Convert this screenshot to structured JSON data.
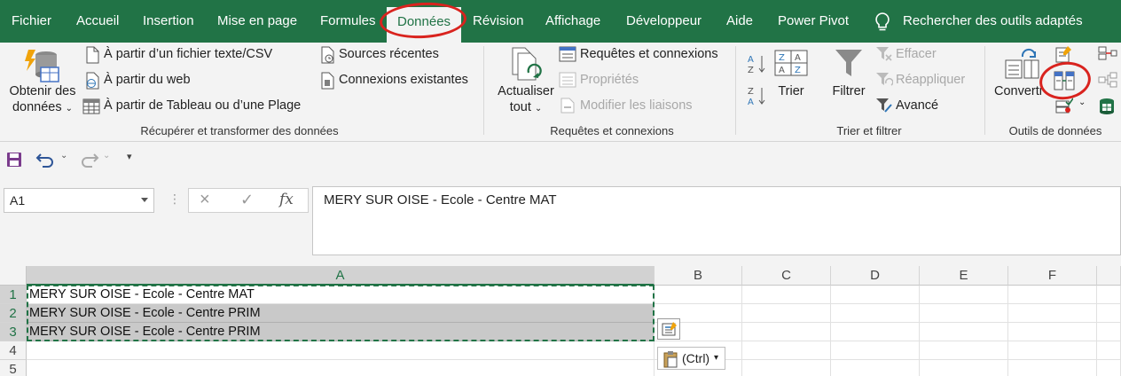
{
  "tabs": [
    {
      "label": "Fichier",
      "active": false
    },
    {
      "label": "Accueil",
      "active": false
    },
    {
      "label": "Insertion",
      "active": false
    },
    {
      "label": "Mise en page",
      "active": false
    },
    {
      "label": "Formules",
      "active": false
    },
    {
      "label": "Données",
      "active": true
    },
    {
      "label": "Révision",
      "active": false
    },
    {
      "label": "Affichage",
      "active": false
    },
    {
      "label": "Développeur",
      "active": false
    },
    {
      "label": "Aide",
      "active": false
    },
    {
      "label": "Power Pivot",
      "active": false
    }
  ],
  "search": {
    "label": "Rechercher des outils adaptés",
    "icon": "lightbulb-icon"
  },
  "ribbon": {
    "get_transform": {
      "get_data": {
        "line1": "Obtenir des",
        "line2": "données"
      },
      "from_text_csv": "À partir d’un fichier texte/CSV",
      "from_web": "À partir du web",
      "from_table": "À partir de Tableau ou d’une Plage",
      "recent_sources": "Sources récentes",
      "existing_connections": "Connexions existantes",
      "group_label": "Récupérer et transformer des données"
    },
    "queries": {
      "refresh": {
        "line1": "Actualiser",
        "line2": "tout"
      },
      "queries_connections": "Requêtes et connexions",
      "properties": "Propriétés",
      "edit_links": "Modifier les liaisons",
      "group_label": "Requêtes et connexions"
    },
    "sort_filter": {
      "sort": "Trier",
      "filter": "Filtrer",
      "clear": "Effacer",
      "reapply": "Réappliquer",
      "advanced": "Avancé",
      "group_label": "Trier et filtrer"
    },
    "data_tools": {
      "convert": "Converti",
      "group_label": "Outils de données"
    }
  },
  "formula_bar": {
    "name_box": "A1",
    "cancel_icon": "×",
    "confirm_icon": "✓",
    "fx_label": "fx",
    "content": "MERY SUR OISE - Ecole - Centre MAT"
  },
  "grid": {
    "columns": [
      "A",
      "B",
      "C",
      "D",
      "E",
      "F"
    ],
    "rows": [
      "1",
      "2",
      "3",
      "4",
      "5"
    ],
    "cells": {
      "A1": "MERY SUR OISE - Ecole - Centre MAT",
      "A2": "MERY SUR OISE - Ecole - Centre PRIM",
      "A3": "MERY SUR OISE - Ecole - Centre PRIM"
    }
  },
  "paste_options": {
    "label": "(Ctrl)"
  },
  "colors": {
    "accent": "#217346",
    "annotation": "#d9231e"
  }
}
